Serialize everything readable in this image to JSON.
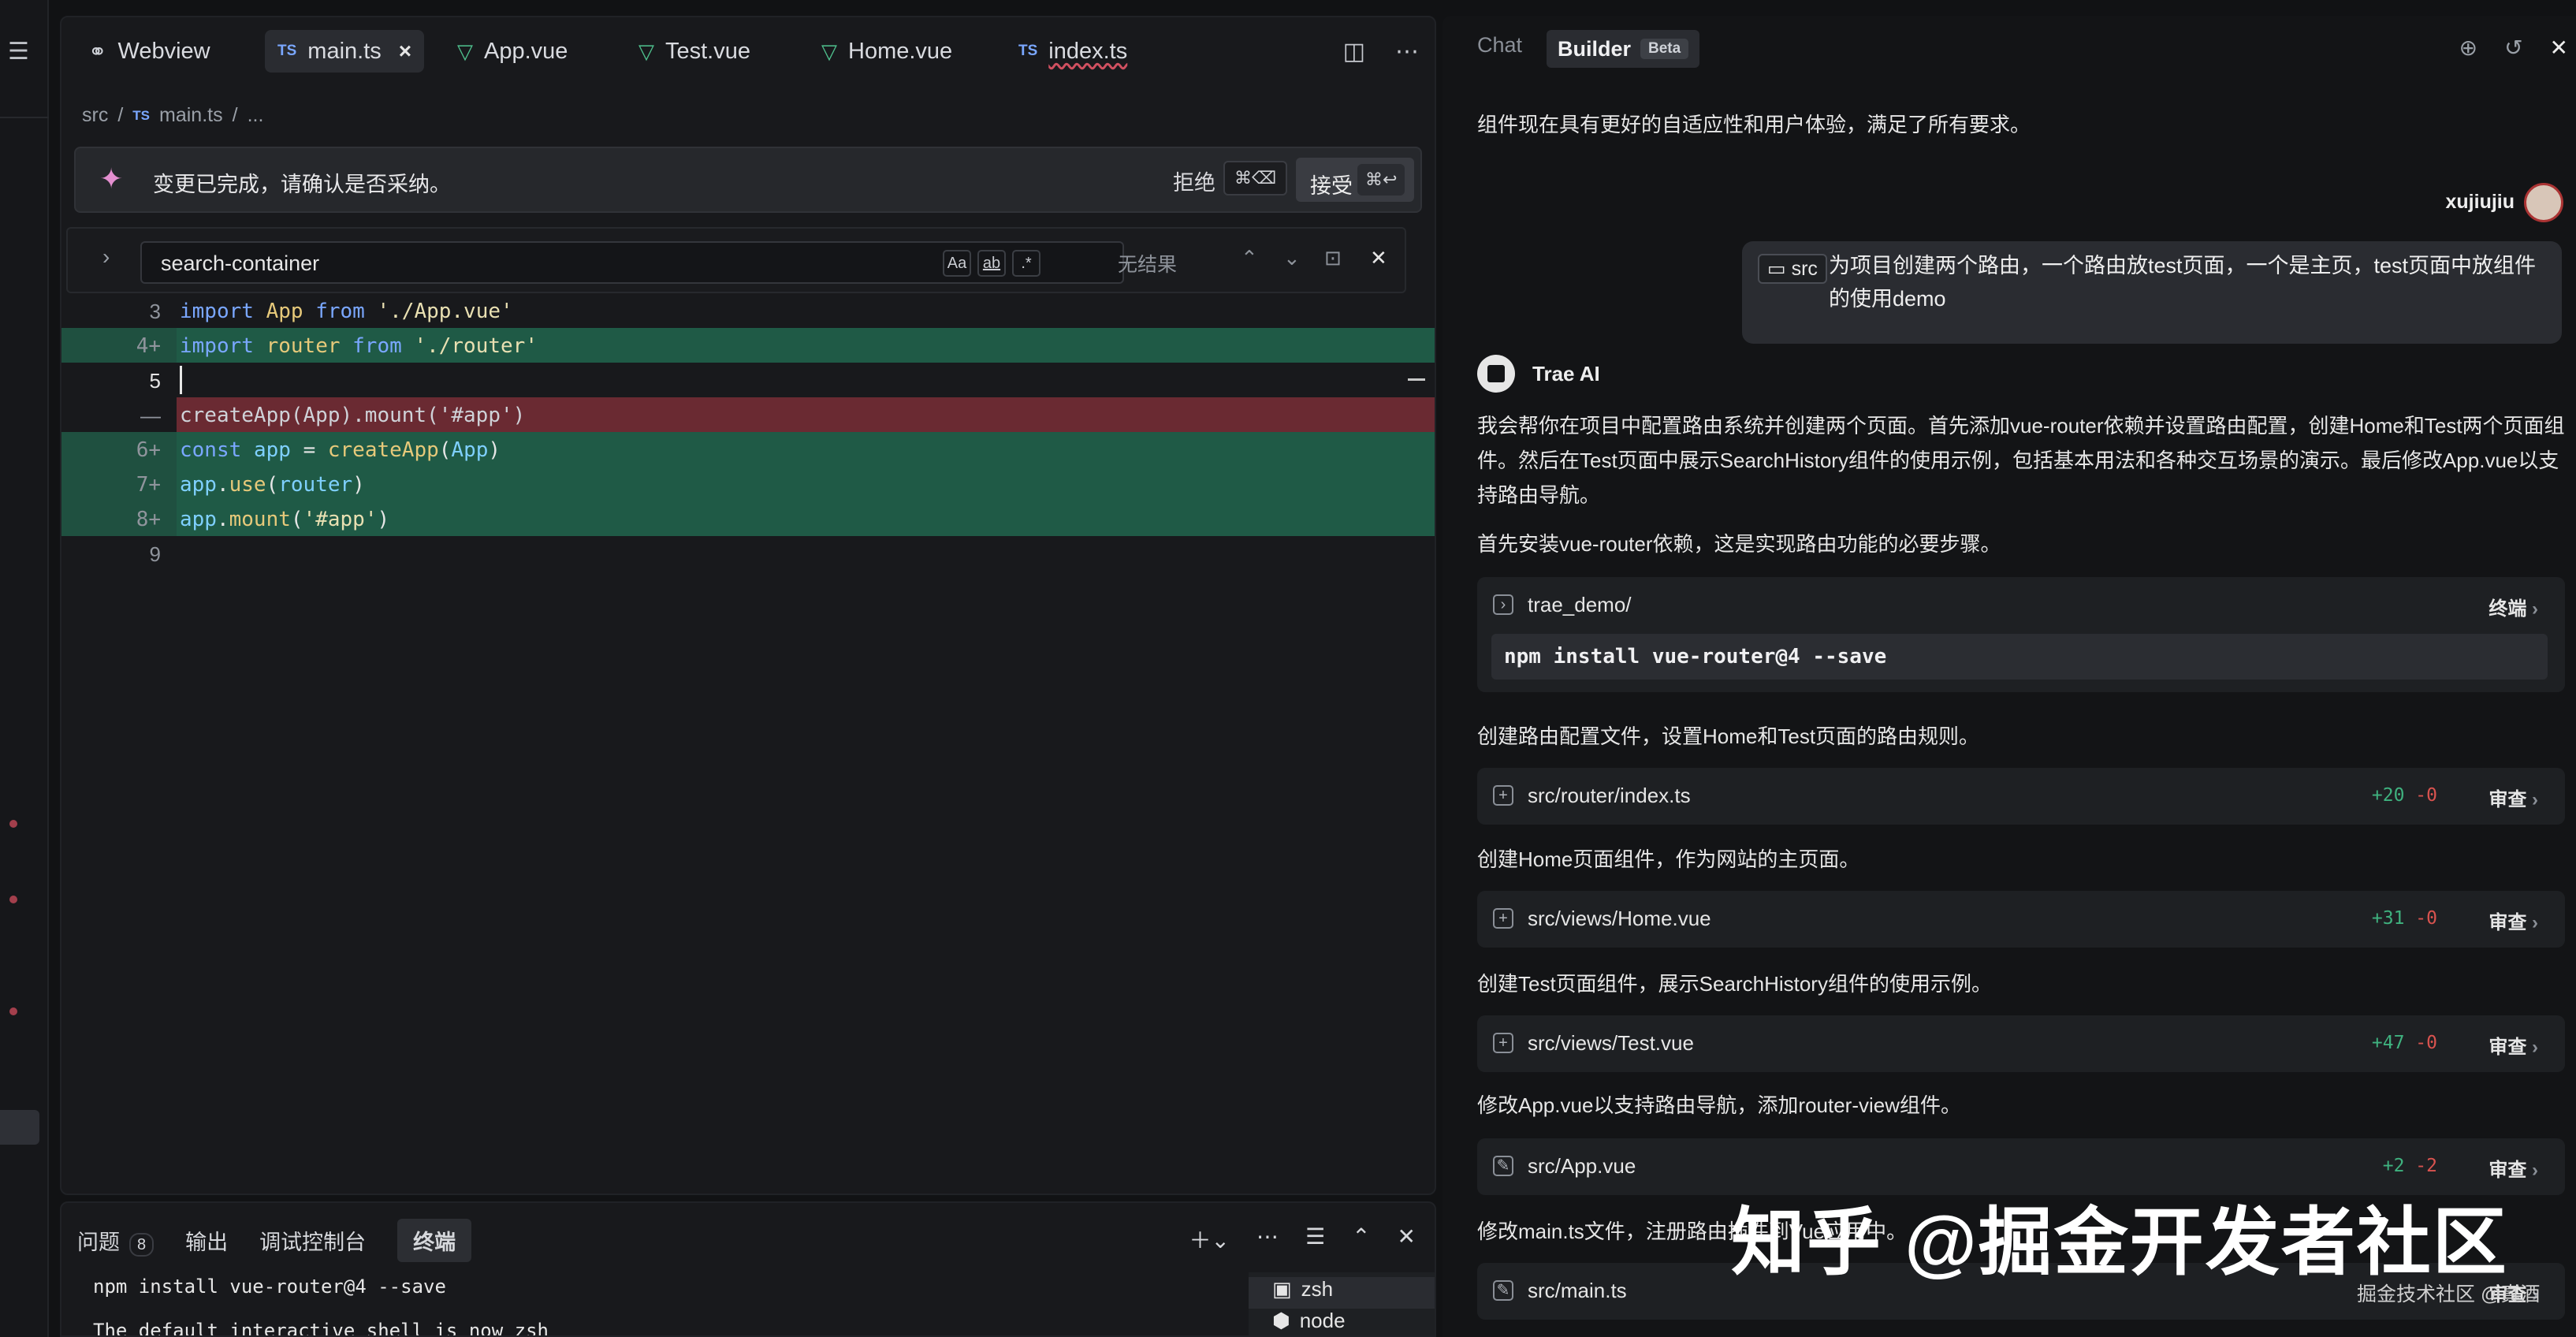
{
  "editor": {
    "tabs": [
      {
        "label": "Webview",
        "icon": "link-icon"
      },
      {
        "label": "main.ts",
        "icon": "ts-icon",
        "prefix": "TS",
        "active": true
      },
      {
        "label": "App.vue",
        "icon": "vue-icon"
      },
      {
        "label": "Test.vue",
        "icon": "vue-icon"
      },
      {
        "label": "Home.vue",
        "icon": "vue-icon"
      },
      {
        "label": "index.ts",
        "icon": "ts-icon",
        "prefix": "TS"
      }
    ],
    "breadcrumb": {
      "dir": "src",
      "sep": "/",
      "prefix": "TS",
      "file": "main.ts",
      "more": "..."
    },
    "banner": {
      "message": "变更已完成，请确认是否采纳。",
      "reject": "拒绝",
      "reject_key": "⌘⌫",
      "accept": "接受",
      "accept_key": "⌘↩"
    },
    "find": {
      "value": "search-container",
      "opt_case": "Aa",
      "opt_word": "ab",
      "opt_regex": ".*",
      "result": "无结果"
    },
    "code": [
      {
        "num": "3",
        "mark": "",
        "text": "import App from './App.vue'",
        "type": "normal"
      },
      {
        "num": "4",
        "mark": "+",
        "text": "import router from './router'",
        "type": "add"
      },
      {
        "num": "5",
        "mark": "",
        "text": "",
        "type": "add-cursor"
      },
      {
        "num": "",
        "mark": "—",
        "text": "createApp(App).mount('#app')",
        "type": "del"
      },
      {
        "num": "6",
        "mark": "+",
        "text": "const app = createApp(App)",
        "type": "add"
      },
      {
        "num": "7",
        "mark": "+",
        "text": "app.use(router)",
        "type": "add"
      },
      {
        "num": "8",
        "mark": "+",
        "text": "app.mount('#app')",
        "type": "add"
      },
      {
        "num": "9",
        "mark": "",
        "text": "",
        "type": "normal"
      }
    ]
  },
  "terminal": {
    "tabs": [
      {
        "label": "问题",
        "badge": "8"
      },
      {
        "label": "输出"
      },
      {
        "label": "调试控制台"
      },
      {
        "label": "终端",
        "active": true
      }
    ],
    "lines": [
      "npm install vue-router@4 --save",
      "The default interactive shell is now zsh"
    ],
    "sessions": [
      "zsh",
      "node"
    ]
  },
  "chat": {
    "tabs": {
      "chat": "Chat",
      "builder": "Builder",
      "beta": "Beta"
    },
    "prev_text": "组件现在具有更好的自适应性和用户体验，满足了所有要求。",
    "user": {
      "name": "xujiujiu",
      "chip": "src",
      "message": "为项目创建两个路由，一个路由放test页面，一个是主页，test页面中放组件的使用demo"
    },
    "ai_name": "Trae AI",
    "intro": "我会帮你在项目中配置路由系统并创建两个页面。首先添加vue-router依赖并设置路由配置，创建Home和Test两个页面组件。然后在Test页面中展示SearchHistory组件的使用示例，包括基本用法和各种交互场景的演示。最后修改App.vue以支持路由导航。",
    "step1": "首先安装vue-router依赖，这是实现路由功能的必要步骤。",
    "terminal_card": {
      "path": "trae_demo/",
      "label": "终端",
      "command": "npm install vue-router@4 --save"
    },
    "step2": "创建路由配置文件，设置Home和Test页面的路由规则。",
    "step3": "创建Home页面组件，作为网站的主页面。",
    "step4": "创建Test页面组件，展示SearchHistory组件的使用示例。",
    "step5": "修改App.vue以支持路由导航，添加router-view组件。",
    "step6": "修改main.ts文件，注册路由插件到Vue应用中。",
    "files": [
      {
        "name": "src/router/index.ts",
        "add": "+20",
        "del": "-0",
        "review": "审查",
        "icon": "plus-icon"
      },
      {
        "name": "src/views/Home.vue",
        "add": "+31",
        "del": "-0",
        "review": "审查",
        "icon": "plus-icon"
      },
      {
        "name": "src/views/Test.vue",
        "add": "+47",
        "del": "-0",
        "review": "审查",
        "icon": "plus-icon"
      },
      {
        "name": "src/App.vue",
        "add": "+2",
        "del": "-2",
        "review": "审查",
        "icon": "edit-icon"
      },
      {
        "name": "src/main.ts",
        "add": "",
        "del": "",
        "review": "审查",
        "icon": "edit-icon"
      }
    ]
  },
  "watermark": {
    "main": "知乎 @掘金开发者社区",
    "small": "掘金技术社区 @真酒"
  }
}
